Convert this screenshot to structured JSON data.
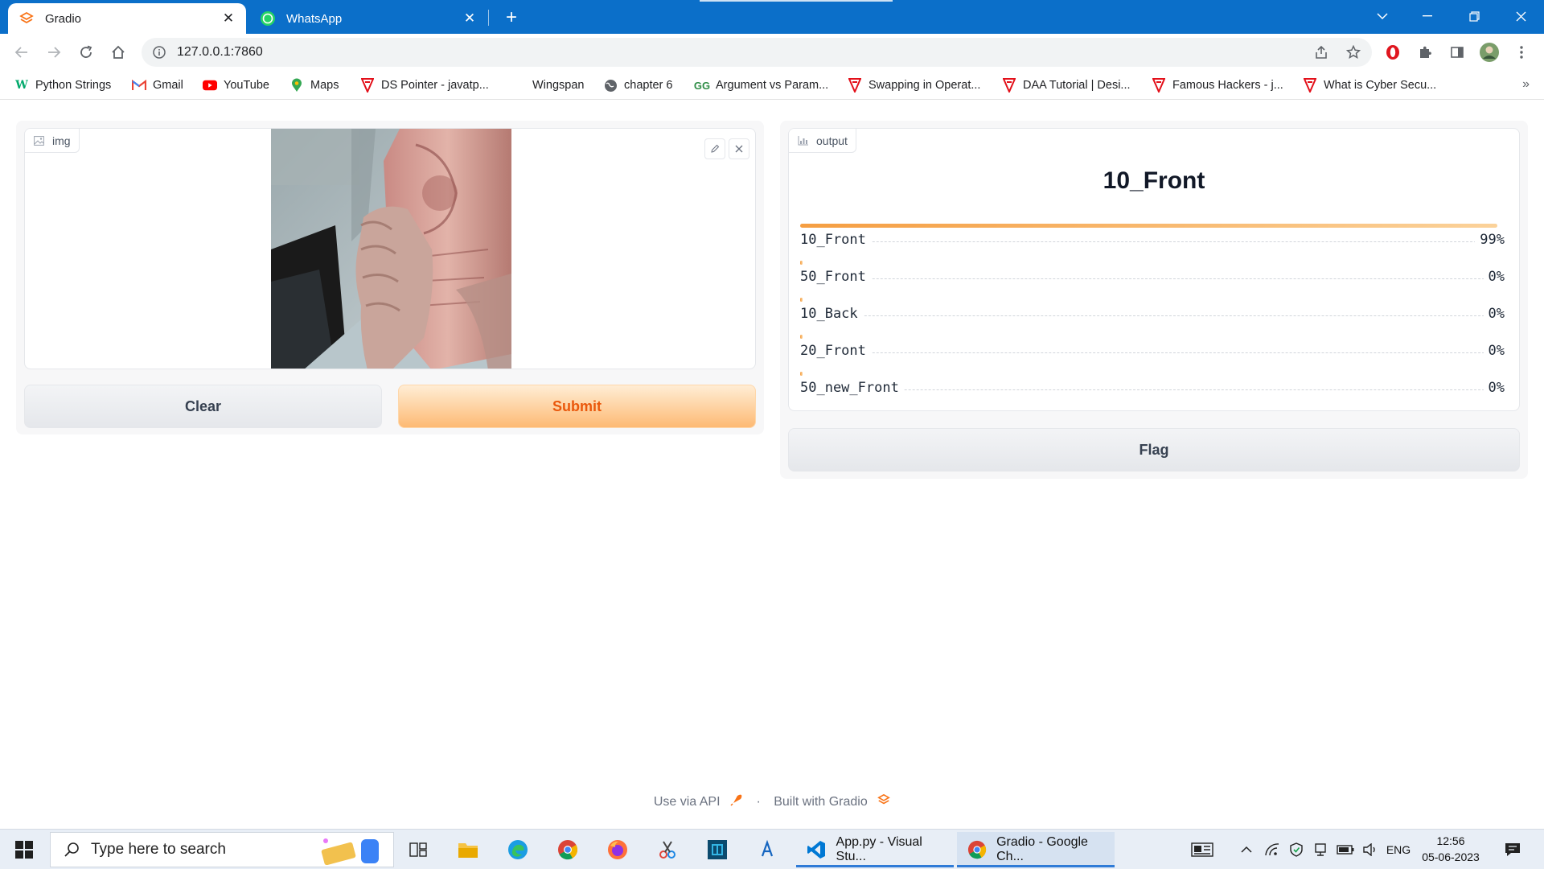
{
  "browser": {
    "tabs": [
      {
        "title": "Gradio",
        "active": true
      },
      {
        "title": "WhatsApp",
        "active": false
      }
    ],
    "url": "127.0.0.1:7860",
    "bookmarks": [
      {
        "label": "Python Strings",
        "icon": "w3schools-icon"
      },
      {
        "label": "Gmail",
        "icon": "gmail-icon"
      },
      {
        "label": "YouTube",
        "icon": "youtube-icon"
      },
      {
        "label": "Maps",
        "icon": "maps-icon"
      },
      {
        "label": "DS Pointer - javatp...",
        "icon": "javatpoint-icon"
      },
      {
        "label": "Wingspan",
        "icon": "blank-icon"
      },
      {
        "label": "chapter 6",
        "icon": "globe-icon"
      },
      {
        "label": "Argument vs Param...",
        "icon": "geeksforgeeks-icon"
      },
      {
        "label": "Swapping in Operat...",
        "icon": "javatpoint-icon"
      },
      {
        "label": "DAA Tutorial | Desi...",
        "icon": "javatpoint-icon"
      },
      {
        "label": "Famous Hackers - j...",
        "icon": "javatpoint-icon"
      },
      {
        "label": "What is Cyber Secu...",
        "icon": "javatpoint-icon"
      }
    ],
    "bookmarks_more": "»"
  },
  "gradio": {
    "input_label": "img",
    "clear_label": "Clear",
    "submit_label": "Submit",
    "output_label": "output",
    "predicted_class": "10_Front",
    "flag_label": "Flag",
    "confidences": [
      {
        "label": "10_Front",
        "value_text": "99%",
        "fraction": 0.99
      },
      {
        "label": "50_Front",
        "value_text": "0%",
        "fraction": 0.0
      },
      {
        "label": "10_Back",
        "value_text": "0%",
        "fraction": 0.0
      },
      {
        "label": "20_Front",
        "value_text": "0%",
        "fraction": 0.0
      },
      {
        "label": "50_new_Front",
        "value_text": "0%",
        "fraction": 0.0
      }
    ],
    "footer": {
      "api_text": "Use via API",
      "separator": "·",
      "built_text": "Built with Gradio"
    }
  },
  "taskbar": {
    "search_placeholder": "Type here to search",
    "apps": [
      {
        "label": "App.py - Visual Stu...",
        "icon": "vscode-icon",
        "active": false
      },
      {
        "label": "Gradio - Google Ch...",
        "icon": "chrome-icon",
        "active": true
      }
    ],
    "language": "ENG",
    "time": "12:56",
    "date": "05-06-2023"
  },
  "colors": {
    "chrome_frame": "#0b6fc9",
    "accent_orange": "#f59e42",
    "primary_button_text": "#ea580c"
  }
}
